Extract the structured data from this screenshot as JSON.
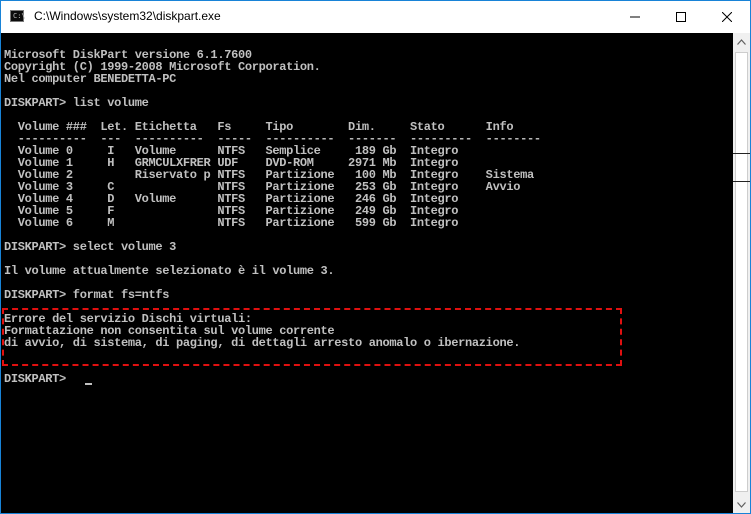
{
  "window": {
    "title": "C:\\Windows\\system32\\diskpart.exe",
    "icon_glyph": "C:\\",
    "icons": {
      "app": "console-app-icon",
      "minimize": "minimize-icon",
      "maximize": "maximize-icon",
      "close": "close-icon"
    }
  },
  "console": {
    "colors": {
      "background": "#000000",
      "text": "#c0c0c0",
      "highlight_border": "#e01010"
    },
    "lines": [
      "Microsoft DiskPart versione 6.1.7600",
      "Copyright (C) 1999-2008 Microsoft Corporation.",
      "Nel computer BENEDETTA-PC",
      "",
      "DISKPART> list volume",
      "",
      "  Volume ###  Let. Etichetta   Fs     Tipo        Dim.     Stato      Info",
      "  ----------  ---  ----------  -----  ----------  -------  ---------  --------",
      "  Volume 0     I   Volume      NTFS   Semplice     189 Gb  Integro",
      "  Volume 1     H   GRMCULXFRER UDF    DVD-ROM     2971 Mb  Integro",
      "  Volume 2         Riservato p NTFS   Partizione   100 Mb  Integro    Sistema",
      "  Volume 3     C               NTFS   Partizione   253 Gb  Integro    Avvio",
      "  Volume 4     D   Volume      NTFS   Partizione   246 Gb  Integro",
      "  Volume 5     F               NTFS   Partizione   249 Gb  Integro",
      "  Volume 6     M               NTFS   Partizione   599 Gb  Integro",
      "",
      "DISKPART> select volume 3",
      "",
      "Il volume attualmente selezionato è il volume 3.",
      "",
      "DISKPART> format fs=ntfs",
      "",
      "Errore del servizio Dischi virtuali:",
      "Formattazione non consentita sul volume corrente",
      "di avvio, di sistema, di paging, di dettagli arresto anomalo o ibernazione.",
      "",
      "DISKPART> "
    ]
  },
  "scrollbar": {
    "up_icon": "scroll-up-arrow-icon",
    "down_icon": "scroll-down-arrow-icon"
  }
}
